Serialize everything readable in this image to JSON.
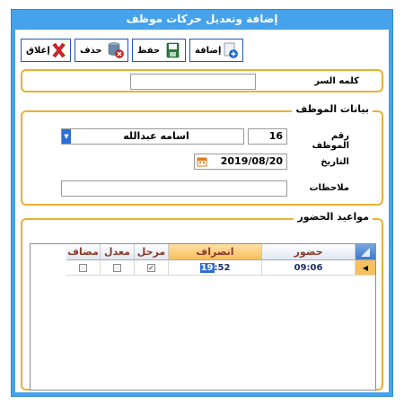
{
  "window": {
    "title": "إضافة وتعديل حركات موظف"
  },
  "toolbar": {
    "add_label": "إضافة",
    "save_label": "حفظ",
    "delete_label": "حذف",
    "close_label": "إغلاق"
  },
  "password": {
    "label": "كلمه السر",
    "value": ""
  },
  "employee": {
    "legend": "بيانات الموظف",
    "number_label": "رقم الموظف",
    "number_value": "16",
    "name_value": "اسامه عبدالله",
    "date_label": "التاريخ",
    "date_value": "2019/08/20",
    "notes_label": "ملاحظات",
    "notes_value": ""
  },
  "attendance": {
    "legend": "مواعيد الحضور",
    "columns": {
      "checkin": "حضور",
      "checkout": "انصراف",
      "posted": "مرحل",
      "modified": "معدل",
      "added": "مضاف"
    },
    "rows": [
      {
        "checkin": "09:06",
        "checkout_hour": "19",
        "checkout_rest": ":52",
        "posted": true,
        "modified": false,
        "added": false
      }
    ]
  },
  "colors": {
    "title_bar": "#46a2ea",
    "group_border": "#efb02d",
    "selected_header": "#f9c86a",
    "accent_blue": "#1f57b5"
  }
}
